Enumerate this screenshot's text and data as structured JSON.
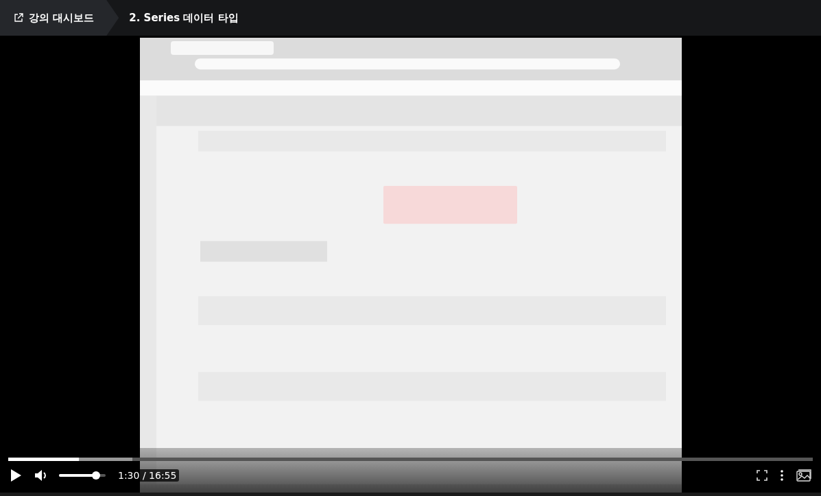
{
  "header": {
    "back_link": "강의 대시보드",
    "lesson_title": "2. Series 데이터 타입"
  },
  "controls": {
    "progress": {
      "level": 0.088
    },
    "playing": false,
    "volume": {
      "level": 0.8
    },
    "current_time": "1:30",
    "separator": "/",
    "duration": "16:55"
  }
}
